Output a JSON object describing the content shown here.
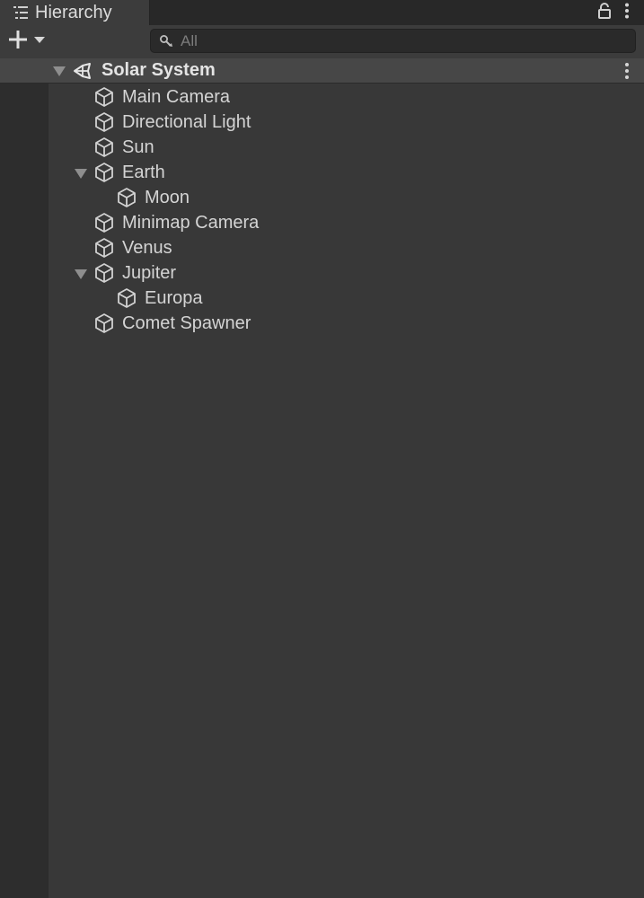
{
  "tab": {
    "label": "Hierarchy",
    "icon": "list-icon",
    "lock_icon": "lock-icon",
    "menu_icon": "kebab-menu-icon"
  },
  "toolbar": {
    "add_icon": "plus-icon",
    "dropdown_icon": "triangle-down-icon",
    "search": {
      "placeholder": "All",
      "value": "",
      "icon": "search-icon"
    }
  },
  "scene": {
    "name": "Solar System",
    "icon": "unity-scene-icon",
    "expanded": true,
    "menu_icon": "kebab-menu-icon"
  },
  "items": [
    {
      "label": "Main Camera",
      "depth": 1,
      "has_children": false
    },
    {
      "label": "Directional Light",
      "depth": 1,
      "has_children": false
    },
    {
      "label": "Sun",
      "depth": 1,
      "has_children": false
    },
    {
      "label": "Earth",
      "depth": 1,
      "has_children": true,
      "expanded": true
    },
    {
      "label": "Moon",
      "depth": 2,
      "has_children": false
    },
    {
      "label": "Minimap Camera",
      "depth": 1,
      "has_children": false
    },
    {
      "label": "Venus",
      "depth": 1,
      "has_children": false
    },
    {
      "label": "Jupiter",
      "depth": 1,
      "has_children": true,
      "expanded": true
    },
    {
      "label": "Europa",
      "depth": 2,
      "has_children": false
    },
    {
      "label": "Comet Spawner",
      "depth": 1,
      "has_children": false
    }
  ],
  "colors": {
    "background": "#383838",
    "tab_bar": "#282828",
    "scene_row": "#474747",
    "gutter": "#2d2d2d",
    "text": "#d4d4d4"
  }
}
